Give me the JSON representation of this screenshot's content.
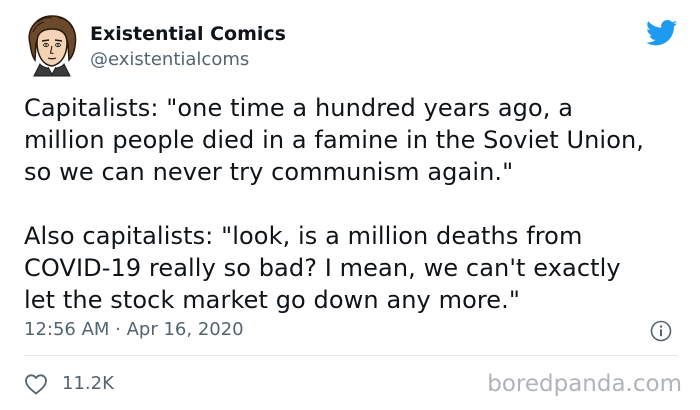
{
  "author": {
    "display_name": "Existential Comics",
    "handle": "@existentialcoms",
    "avatar_icon": "cartoon-portrait-avatar"
  },
  "tweet": {
    "paragraphs": [
      "Capitalists: \"one time a hundred years ago, a\nmillion people died in a famine in the Soviet Union,\nso we can never try communism again.\"",
      "Also capitalists: \"look, is a million deaths from\nCOVID-19 really so bad? I mean, we can't exactly\nlet the stock market go down any more.\""
    ],
    "timestamp": "12:56 AM · Apr 16, 2020"
  },
  "engagement": {
    "likes": "11.2K"
  },
  "icons": {
    "brand": "twitter-bird-icon",
    "info": "info-icon",
    "like": "heart-icon"
  },
  "watermark": "boredpanda.com",
  "colors": {
    "twitter_blue": "#1d9bf0",
    "text_primary": "#0f1419",
    "text_secondary": "#536471",
    "divider": "#e1e8ed",
    "watermark": "#b0b4b8"
  }
}
